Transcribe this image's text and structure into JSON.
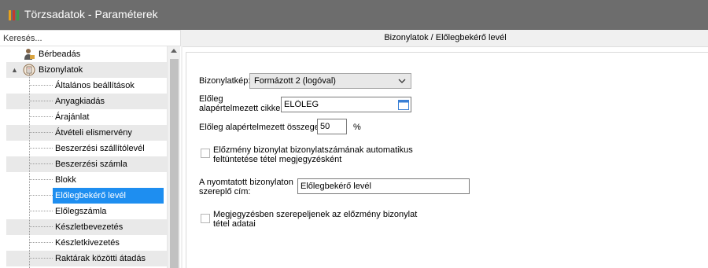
{
  "window": {
    "title": "Törzsadatok - Paraméterek",
    "icon_colors": [
      "#e8a31b",
      "#c53b2d",
      "#3b9b4a"
    ]
  },
  "sidebar": {
    "search_placeholder": "Keresés...",
    "tree": [
      {
        "label": "Bérbeadás",
        "level": 0,
        "icon": "person-icon"
      },
      {
        "label": "Bizonylatok",
        "level": 0,
        "icon": "document-stack-icon",
        "expanded": true
      },
      {
        "label": "Általános beállítások",
        "level": 1
      },
      {
        "label": "Anyagkiadás",
        "level": 1
      },
      {
        "label": "Árajánlat",
        "level": 1
      },
      {
        "label": "Átvételi elismervény",
        "level": 1
      },
      {
        "label": "Beszerzési szállítólevél",
        "level": 1
      },
      {
        "label": "Beszerzési számla",
        "level": 1
      },
      {
        "label": "Blokk",
        "level": 1
      },
      {
        "label": "Előlegbekérő levél",
        "level": 1,
        "selected": true
      },
      {
        "label": "Előlegszámla",
        "level": 1
      },
      {
        "label": "Készletbevezetés",
        "level": 1
      },
      {
        "label": "Készletkivezetés",
        "level": 1
      },
      {
        "label": "Raktárak közötti átadás",
        "level": 1
      }
    ]
  },
  "main": {
    "header": "Bizonylatok / Előlegbekérő levél",
    "form": {
      "bizonylatkep_label": "Bizonylatkép:",
      "bizonylatkep_value": "Formázott 2 (logóval)",
      "cikk_label_line1": "Előleg",
      "cikk_label_line2": "alapértelmezett cikke:",
      "cikk_value": "ELŐLEG",
      "osszeg_label": "Előleg alapértelmezett összege:",
      "osszeg_value": "50",
      "osszeg_unit": "%",
      "checkbox1_line1": "Előzmény bizonylat bizonylatszámának automatikus",
      "checkbox1_line2": "feltüntetése tétel megjegyzésként",
      "checkbox1_checked": false,
      "cim_label_line1": "A nyomtatott bizonylaton",
      "cim_label_line2": "szereplő cím:",
      "cim_value": "Előlegbekérő levél",
      "checkbox2_line1": "Megjegyzésben szerepeljenek az előzmény bizonylat",
      "checkbox2_line2": "tétel adatai",
      "checkbox2_checked": false
    }
  },
  "colors": {
    "titlebar": "#6d6d6d",
    "selection": "#1e8ef0",
    "alt_row": "#e9e9e9",
    "calendar_icon": "#3a7fd5"
  }
}
